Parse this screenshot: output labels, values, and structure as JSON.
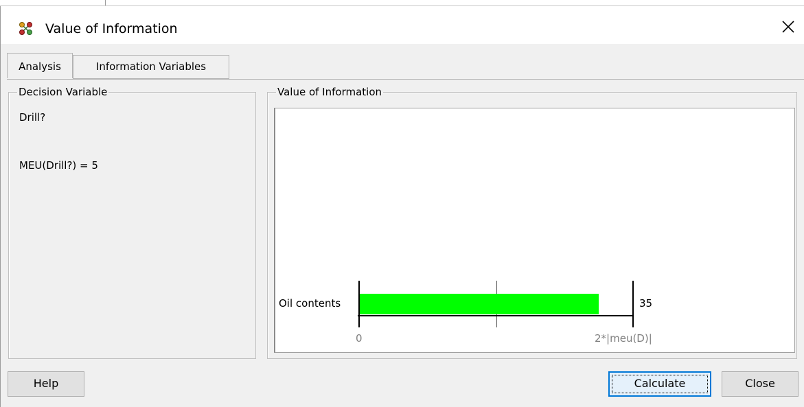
{
  "window": {
    "title": "Value of Information",
    "icon": "network-nodes-icon",
    "close_glyph": "✕"
  },
  "tabs": [
    {
      "label": "Analysis",
      "active": true
    },
    {
      "label": "Information Variables",
      "active": false
    }
  ],
  "decision_panel": {
    "legend": "Decision Variable",
    "variable": "Drill?",
    "meu": "MEU(Drill?) = 5"
  },
  "voi_panel": {
    "legend": "Value of Information",
    "chart_data": {
      "type": "bar",
      "orientation": "horizontal",
      "categories": [
        "Oil contents"
      ],
      "values": [
        35
      ],
      "value_labels": [
        "35"
      ],
      "xlim": [
        0,
        40
      ],
      "tick_labels": [
        "0",
        "2*|meu(D)|"
      ],
      "bar_color": "#00ff00",
      "grid": true
    }
  },
  "buttons": {
    "help": "Help",
    "calculate": "Calculate",
    "close": "Close"
  }
}
